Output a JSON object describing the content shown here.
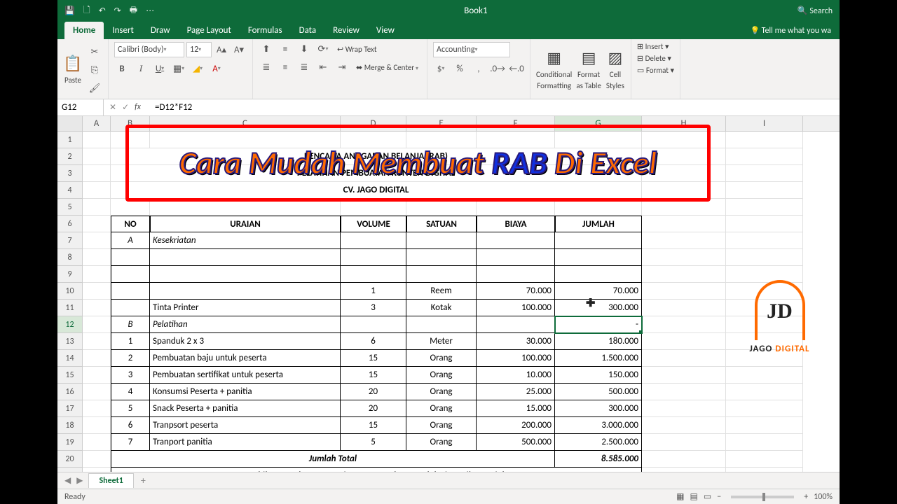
{
  "titlebar": {
    "title": "Book1",
    "search": "Search"
  },
  "tabs": [
    "Home",
    "Insert",
    "Draw",
    "Page Layout",
    "Formulas",
    "Data",
    "Review",
    "View"
  ],
  "tellme": "Tell me what you wa",
  "ribbon": {
    "paste": "Paste",
    "font_name": "Calibri (Body)",
    "font_size": "12",
    "wrap": "Wrap Text",
    "merge": "Merge & Center",
    "number_format": "Accounting",
    "cond": "Conditional",
    "cond2": "Formatting",
    "fmt_table": "Format",
    "fmt_table2": "as Table",
    "cell_styles": "Cell",
    "cell_styles2": "Styles",
    "insert": "Insert",
    "delete": "Delete",
    "format": "Format"
  },
  "formula": {
    "name": "G12",
    "fx": "=D12*F12"
  },
  "cols": [
    "A",
    "B",
    "C",
    "D",
    "E",
    "F",
    "G",
    "H",
    "I"
  ],
  "title_lines": [
    "RENCANA ANGGARAN BELANJA (RAB)",
    "PELATIHAN PEMBUATAN KONTEN DIGITAL",
    "CV. JAGO DIGITAL"
  ],
  "headers": {
    "no": "NO",
    "uraian": "URAIAN",
    "volume": "VOLUME",
    "satuan": "SATUAN",
    "biaya": "BIAYA",
    "jumlah": "JUMLAH"
  },
  "section_a": {
    "id": "A",
    "label": "Kesekriatan"
  },
  "rows_a": [
    {
      "n": "",
      "desc": "",
      "vol": "",
      "sat": "",
      "biaya": "",
      "jumlah": ""
    },
    {
      "n": "",
      "desc": "",
      "vol": "",
      "sat": "",
      "biaya": "",
      "jumlah": ""
    },
    {
      "n": "",
      "desc": "",
      "vol": "1",
      "sat": "Reem",
      "biaya": "70.000",
      "jumlah": "70.000"
    },
    {
      "n": "",
      "desc": "Tinta Printer",
      "vol": "3",
      "sat": "Kotak",
      "biaya": "100.000",
      "jumlah": "300.000"
    }
  ],
  "section_b": {
    "id": "B",
    "label": "Pelatihan",
    "jumlah": "-"
  },
  "rows_b": [
    {
      "n": "1",
      "desc": "Spanduk 2 x 3",
      "vol": "6",
      "sat": "Meter",
      "biaya": "30.000",
      "jumlah": "180.000"
    },
    {
      "n": "2",
      "desc": "Pembuatan baju untuk peserta",
      "vol": "15",
      "sat": "Orang",
      "biaya": "100.000",
      "jumlah": "1.500.000"
    },
    {
      "n": "3",
      "desc": "Pembuatan sertifikat untuk peserta",
      "vol": "15",
      "sat": "Orang",
      "biaya": "10.000",
      "jumlah": "150.000"
    },
    {
      "n": "4",
      "desc": "Konsumsi Peserta + panitia",
      "vol": "20",
      "sat": "Orang",
      "biaya": "25.000",
      "jumlah": "500.000"
    },
    {
      "n": "5",
      "desc": "Snack Peserta + panitia",
      "vol": "20",
      "sat": "Orang",
      "biaya": "15.000",
      "jumlah": "300.000"
    },
    {
      "n": "6",
      "desc": "Tranpsort peserta",
      "vol": "15",
      "sat": "Orang",
      "biaya": "200.000",
      "jumlah": "3.000.000"
    },
    {
      "n": "7",
      "desc": "Tranport panitia",
      "vol": "5",
      "sat": "Orang",
      "biaya": "500.000",
      "jumlah": "2.500.000"
    }
  ],
  "total": {
    "label": "Jumlah Total",
    "value": "8.585.000"
  },
  "terbilang": "Terbilang : Delapan Juta Lima Ratus Delapan Puluh Lima Ribu Rupiah",
  "sheet": "Sheet1",
  "status": "Ready",
  "zoom": "100%",
  "overlay": {
    "pre": "Cara Mudah Membuat ",
    "rab": "RAB",
    "post": " Di Excel"
  },
  "logo": {
    "brand1": "JAGO ",
    "brand2": "DIGITAL",
    "mono": "JD"
  }
}
